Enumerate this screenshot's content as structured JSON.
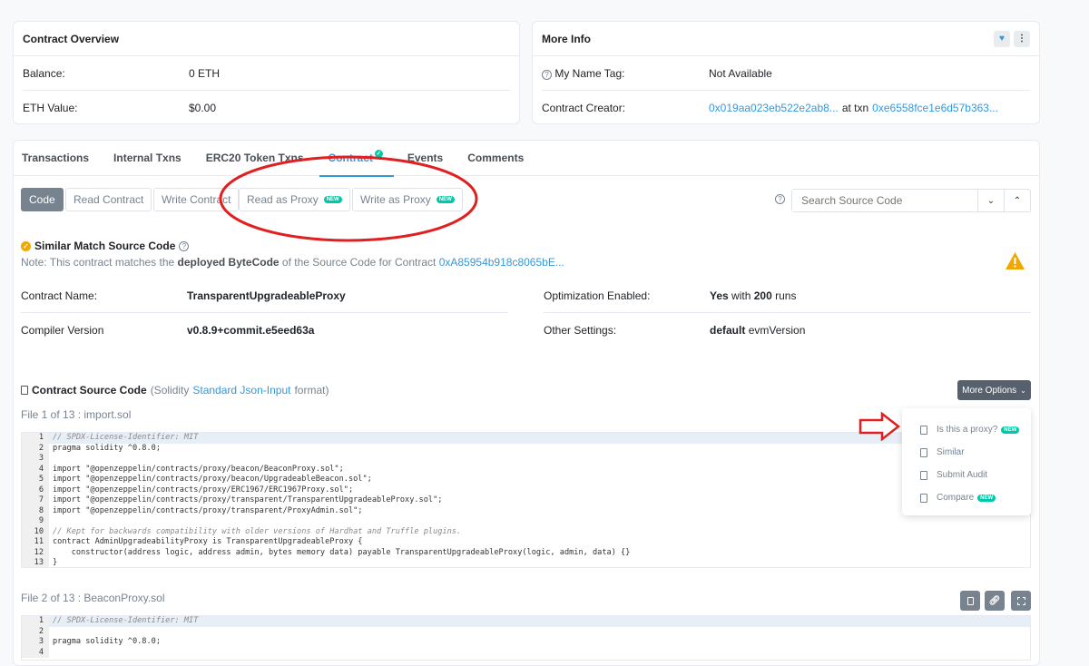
{
  "overview": {
    "title": "Contract Overview",
    "balance_label": "Balance:",
    "balance_value": "0 ETH",
    "eth_value_label": "ETH Value:",
    "eth_value": "$0.00"
  },
  "more_info": {
    "title": "More Info",
    "name_tag_label": "My Name Tag:",
    "name_tag_value": "Not Available",
    "creator_label": "Contract Creator:",
    "creator_address": "0x019aa023eb522e2ab8...",
    "at_txn": "at txn",
    "txn_hash": "0xe6558fce1e6d57b363..."
  },
  "tabs": [
    "Transactions",
    "Internal Txns",
    "ERC20 Token Txns",
    "Contract",
    "Events",
    "Comments"
  ],
  "buttons": {
    "code": "Code",
    "read_contract": "Read Contract",
    "write_contract": "Write Contract",
    "read_proxy": "Read as Proxy",
    "write_proxy": "Write as Proxy",
    "new_badge": "NEW"
  },
  "search": {
    "placeholder": "Search Source Code"
  },
  "match": {
    "title": "Similar Match Source Code",
    "note_prefix": "Note: This contract matches the",
    "note_bold": "deployed ByteCode",
    "note_suffix": "of the Source Code for Contract",
    "note_link": "0xA85954b918c8065bE..."
  },
  "details": {
    "contract_name_label": "Contract Name:",
    "contract_name": "TransparentUpgradeableProxy",
    "compiler_label": "Compiler Version",
    "compiler_value": "v0.8.9+commit.e5eed63a",
    "optimization_label": "Optimization Enabled:",
    "optimization_yes": "Yes",
    "optimization_with": "with",
    "optimization_runs": "200",
    "optimization_runs_word": "runs",
    "other_label": "Other Settings:",
    "other_bold": "default",
    "other_value": "evmVersion"
  },
  "source": {
    "title": "Contract Source Code",
    "lang_prefix": "(Solidity",
    "lang_link": "Standard Json-Input",
    "lang_suffix": "format)",
    "more_options": "More Options",
    "file1": "File 1 of 13 : import.sol",
    "file2": "File 2 of 13 : BeaconProxy.sol"
  },
  "dropdown": [
    "Is this a proxy?",
    "Similar",
    "Submit Audit",
    "Compare"
  ],
  "code1": [
    "// SPDX-License-Identifier: MIT",
    "pragma solidity ^0.8.0;",
    "",
    "import \"@openzeppelin/contracts/proxy/beacon/BeaconProxy.sol\";",
    "import \"@openzeppelin/contracts/proxy/beacon/UpgradeableBeacon.sol\";",
    "import \"@openzeppelin/contracts/proxy/ERC1967/ERC1967Proxy.sol\";",
    "import \"@openzeppelin/contracts/proxy/transparent/TransparentUpgradeableProxy.sol\";",
    "import \"@openzeppelin/contracts/proxy/transparent/ProxyAdmin.sol\";",
    "",
    "// Kept for backwards compatibility with older versions of Hardhat and Truffle plugins.",
    "contract AdminUpgradeabilityProxy is TransparentUpgradeableProxy {",
    "    constructor(address logic, address admin, bytes memory data) payable TransparentUpgradeableProxy(logic, admin, data) {}",
    "}"
  ],
  "code2": [
    "// SPDX-License-Identifier: MIT",
    "",
    "pragma solidity ^0.8.0;",
    ""
  ]
}
